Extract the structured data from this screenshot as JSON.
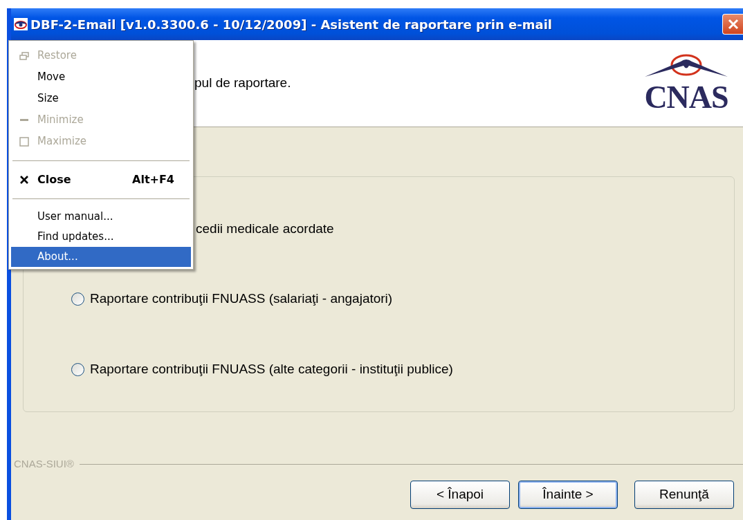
{
  "window": {
    "title": "DBF-2-Email [v1.0.3300.6 - 10/12/2009] - Asistent de raportare prin e-mail"
  },
  "header": {
    "text": "pul de raportare.",
    "logo_text": "CNAS"
  },
  "partial_option": {
    "label": "cedii medicale acordate"
  },
  "options": [
    {
      "label": "Raportare contribuţii FNUASS (salariaţi - angajatori)",
      "selected": false
    },
    {
      "label": "Raportare contribuţii FNUASS (alte categorii - instituţii publice)",
      "selected": false
    }
  ],
  "footer": {
    "brand": "CNAS-SIUI®"
  },
  "buttons": [
    {
      "label": "< Înapoi",
      "default": false
    },
    {
      "label": "Înainte >",
      "default": true
    },
    {
      "label": "Renunţă",
      "default": false
    }
  ],
  "system_menu": [
    {
      "kind": "restore",
      "label": "Restore",
      "disabled": true,
      "bold": false,
      "selected": false
    },
    {
      "kind": "item",
      "label": "Move",
      "disabled": false,
      "bold": false,
      "selected": false
    },
    {
      "kind": "item",
      "label": "Size",
      "disabled": false,
      "bold": false,
      "selected": false
    },
    {
      "kind": "minimize",
      "label": "Minimize",
      "disabled": true,
      "bold": false,
      "selected": false
    },
    {
      "kind": "maximize",
      "label": "Maximize",
      "disabled": true,
      "bold": false,
      "selected": false
    },
    {
      "kind": "separator"
    },
    {
      "kind": "close",
      "label": "Close",
      "shortcut": "Alt+F4",
      "disabled": false,
      "bold": true,
      "selected": false
    },
    {
      "kind": "separator"
    },
    {
      "kind": "item",
      "label": "User manual...",
      "disabled": false,
      "bold": false,
      "selected": false
    },
    {
      "kind": "item",
      "label": "Find updates...",
      "disabled": false,
      "bold": false,
      "selected": false
    },
    {
      "kind": "item",
      "label": "About...",
      "disabled": false,
      "bold": false,
      "selected": true
    }
  ]
}
